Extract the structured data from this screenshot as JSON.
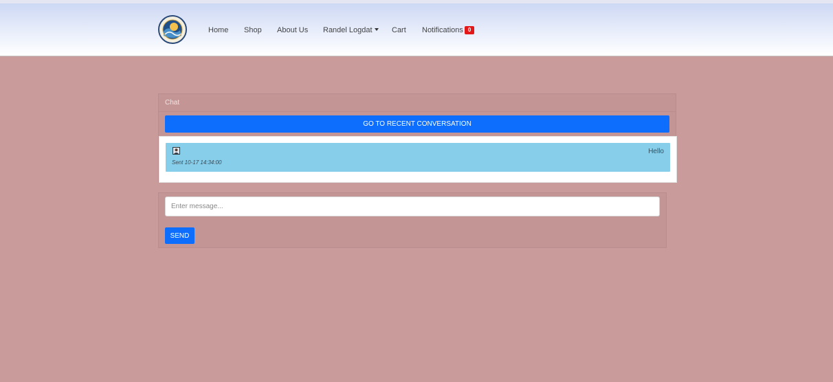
{
  "nav": {
    "logo_icon": "wave-seal-logo-icon",
    "items": [
      {
        "label": "Home"
      },
      {
        "label": "Shop"
      },
      {
        "label": "About Us"
      },
      {
        "label": "Randel Logdat"
      },
      {
        "label": "Cart"
      },
      {
        "label": "Notifications"
      }
    ],
    "notifications_badge": "0",
    "badge_color": "#e31818"
  },
  "chat": {
    "header": "Chat",
    "recent_button": "GO TO RECENT CONVERSATION",
    "messages": [
      {
        "avatar_icon": "user-avatar-icon",
        "sent": "Sent 10-17 14:34:00",
        "text": "Hello"
      }
    ]
  },
  "compose": {
    "placeholder": "Enter message...",
    "value": "",
    "send_label": "SEND"
  },
  "colors": {
    "page_background": "#c99b9b",
    "primary_button": "#0d6efd",
    "message_bubble": "#87ceeb"
  }
}
